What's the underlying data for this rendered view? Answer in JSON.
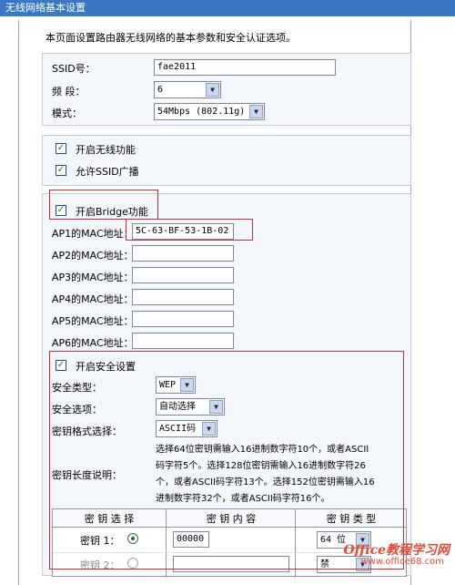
{
  "window": {
    "title": "无线网络基本设置"
  },
  "intro": "本页面设置路由器无线网络的基本参数和安全认证选项。",
  "basic": {
    "ssid_label": "SSID号：",
    "ssid_value": "fae2011",
    "channel_label": "频 段：",
    "channel_value": "6",
    "mode_label": "模式：",
    "mode_value": "54Mbps (802.11g)"
  },
  "options": {
    "enable_wireless": "开启无线功能",
    "enable_ssid_broadcast": "允许SSID广播"
  },
  "bridge": {
    "enable_label": "开启Bridge功能",
    "ap_labels": [
      "AP1的MAC地址：",
      "AP2的MAC地址：",
      "AP3的MAC地址：",
      "AP4的MAC地址：",
      "AP5的MAC地址：",
      "AP6的MAC地址："
    ],
    "ap_values": [
      "5C-63-BF-53-1B-02",
      "",
      "",
      "",
      "",
      ""
    ]
  },
  "security": {
    "enable_label": "开启安全设置",
    "type_label": "安全类型：",
    "type_value": "WEP",
    "option_label": "安全选项：",
    "option_value": "自动选择",
    "key_format_label": "密钥格式选择：",
    "key_format_value": "ASCII码",
    "key_length_label": "密钥长度说明：",
    "key_length_text": [
      "选择64位密钥需输入16进制数字符10个，或者ASCII",
      "码字符5个。选择128位密钥需输入16进制数字符26",
      "个，或者ASCII码字符13个。选择152位密钥需输入16",
      "进制数字符32个，或者ASCII码字符16个。"
    ]
  },
  "key_table": {
    "headers": [
      "密 钥 选 择",
      "密 钥 内 容",
      "密 钥 类 型"
    ],
    "rows": [
      {
        "label": "密钥 1：",
        "value": "00000",
        "type": "64 位"
      },
      {
        "label": "密钥 2：",
        "value": "",
        "type": "禁"
      }
    ]
  },
  "watermark": {
    "brand": "Office教程学习网",
    "url": "www.office68.com"
  }
}
